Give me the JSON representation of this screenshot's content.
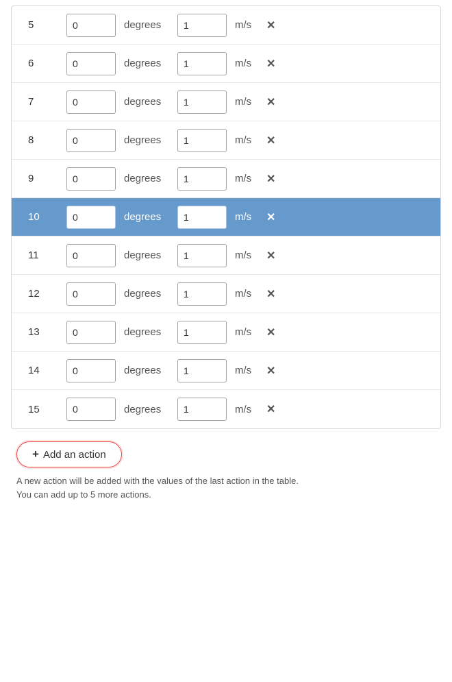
{
  "rows": [
    {
      "id": 5,
      "angle": "0",
      "speed": "1",
      "highlighted": false
    },
    {
      "id": 6,
      "angle": "0",
      "speed": "1",
      "highlighted": false
    },
    {
      "id": 7,
      "angle": "0",
      "speed": "1",
      "highlighted": false
    },
    {
      "id": 8,
      "angle": "0",
      "speed": "1",
      "highlighted": false
    },
    {
      "id": 9,
      "angle": "0",
      "speed": "1",
      "highlighted": false
    },
    {
      "id": 10,
      "angle": "0",
      "speed": "1",
      "highlighted": true
    },
    {
      "id": 11,
      "angle": "0",
      "speed": "1",
      "highlighted": false
    },
    {
      "id": 12,
      "angle": "0",
      "speed": "1",
      "highlighted": false
    },
    {
      "id": 13,
      "angle": "0",
      "speed": "1",
      "highlighted": false
    },
    {
      "id": 14,
      "angle": "0",
      "speed": "1",
      "highlighted": false
    },
    {
      "id": 15,
      "angle": "0",
      "speed": "1",
      "highlighted": false
    }
  ],
  "units": {
    "angle": "degrees",
    "speed": "m/s"
  },
  "add_button": {
    "label": "Add an action",
    "plus": "+"
  },
  "hint_text": "A new action will be added with the values of the last action in the table. You can add up to 5 more actions.",
  "colors": {
    "highlight_bg": "#6699cc",
    "border_highlight": "#e44444"
  }
}
